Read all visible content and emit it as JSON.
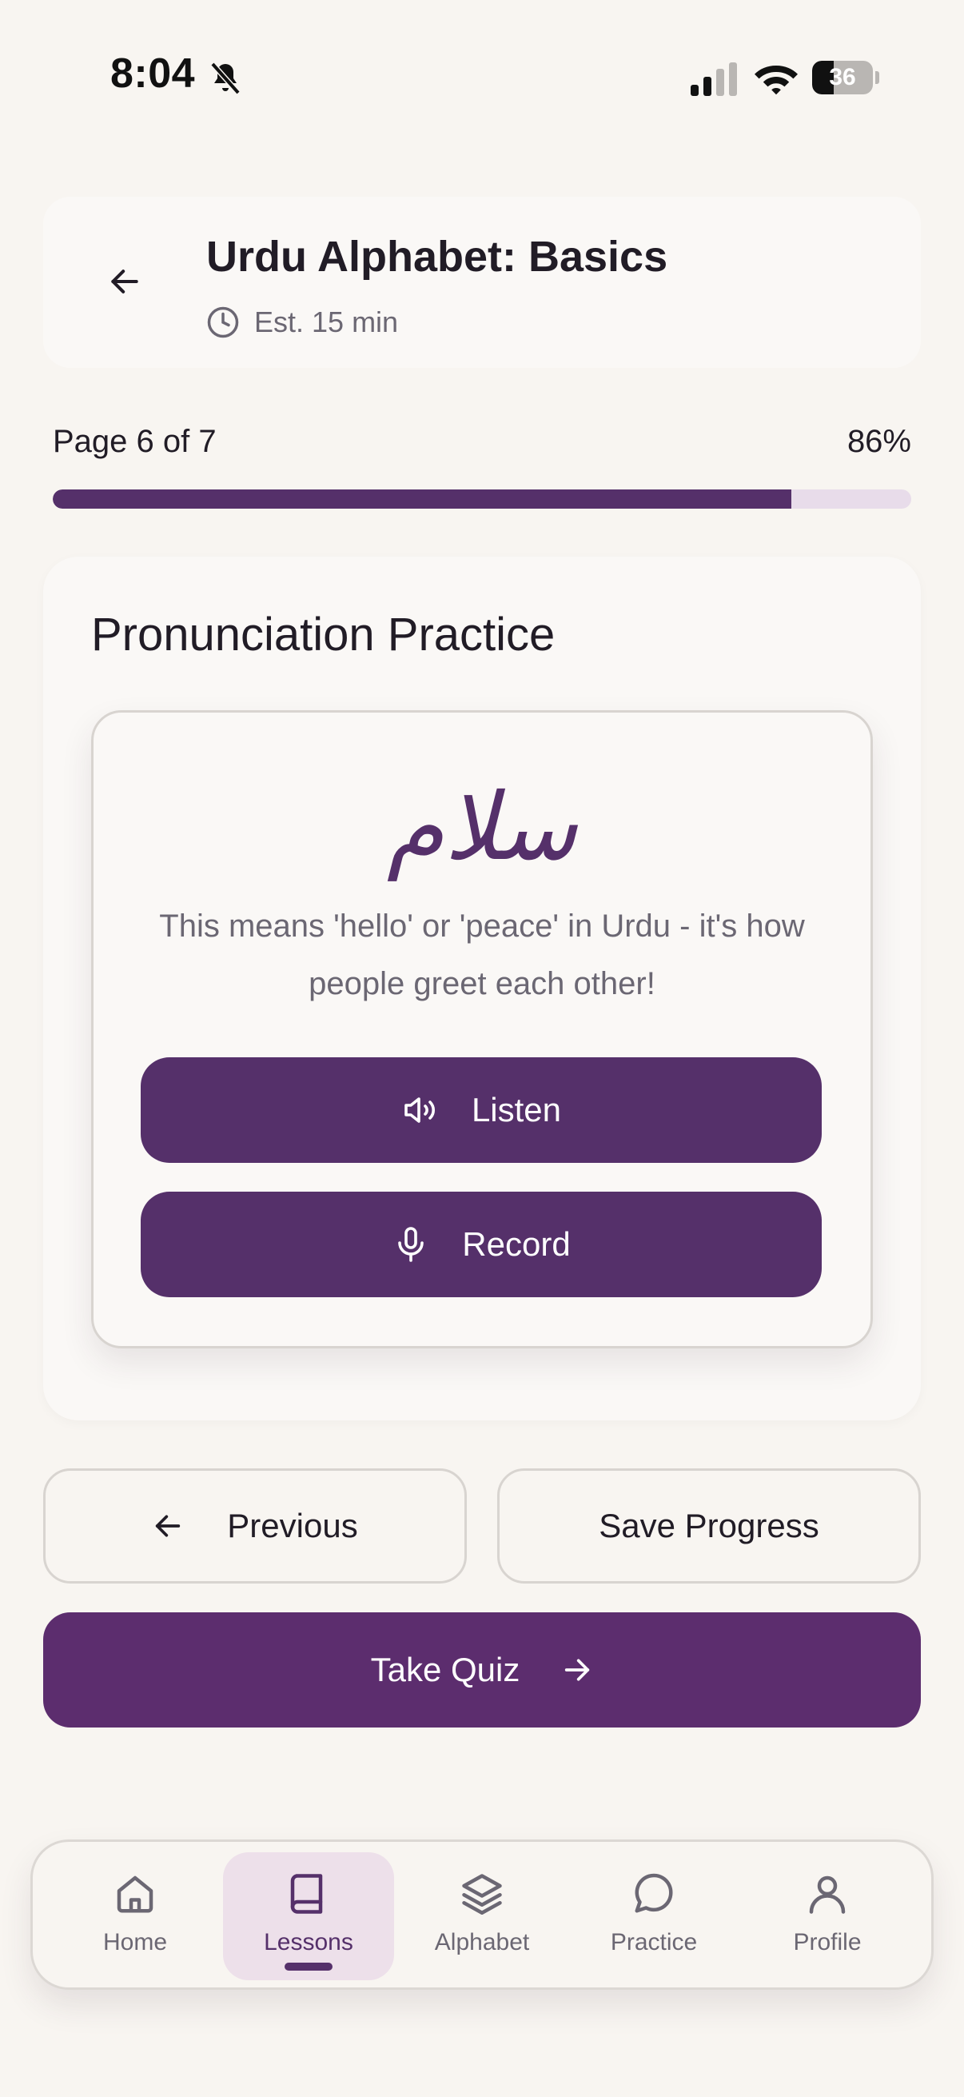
{
  "status_bar": {
    "time": "8:04",
    "battery": "36",
    "battery_fraction": 0.36
  },
  "header": {
    "title": "Urdu Alphabet: Basics",
    "estimate": "Est. 15 min"
  },
  "progress": {
    "page_label": "Page 6 of 7",
    "percent_label": "86%",
    "percent": 86
  },
  "card": {
    "title": "Pronunciation Practice",
    "urdu_word": "سلام",
    "meaning": "This means 'hello' or 'peace' in Urdu - it's how people greet each other!",
    "listen_label": "Listen",
    "record_label": "Record"
  },
  "actions": {
    "previous_label": "Previous",
    "save_label": "Save Progress",
    "quiz_label": "Take Quiz"
  },
  "bottom_nav": {
    "items": [
      {
        "label": "Home",
        "icon": "home-icon"
      },
      {
        "label": "Lessons",
        "icon": "book-icon",
        "active": true
      },
      {
        "label": "Alphabet",
        "icon": "layers-icon"
      },
      {
        "label": "Practice",
        "icon": "chat-bubble-icon"
      },
      {
        "label": "Profile",
        "icon": "user-icon"
      }
    ]
  },
  "colors": {
    "primary": "#55306a",
    "background": "#f8f5f1",
    "active_nav_bg": "#ede0ea",
    "progress_track": "#e8dcea"
  }
}
